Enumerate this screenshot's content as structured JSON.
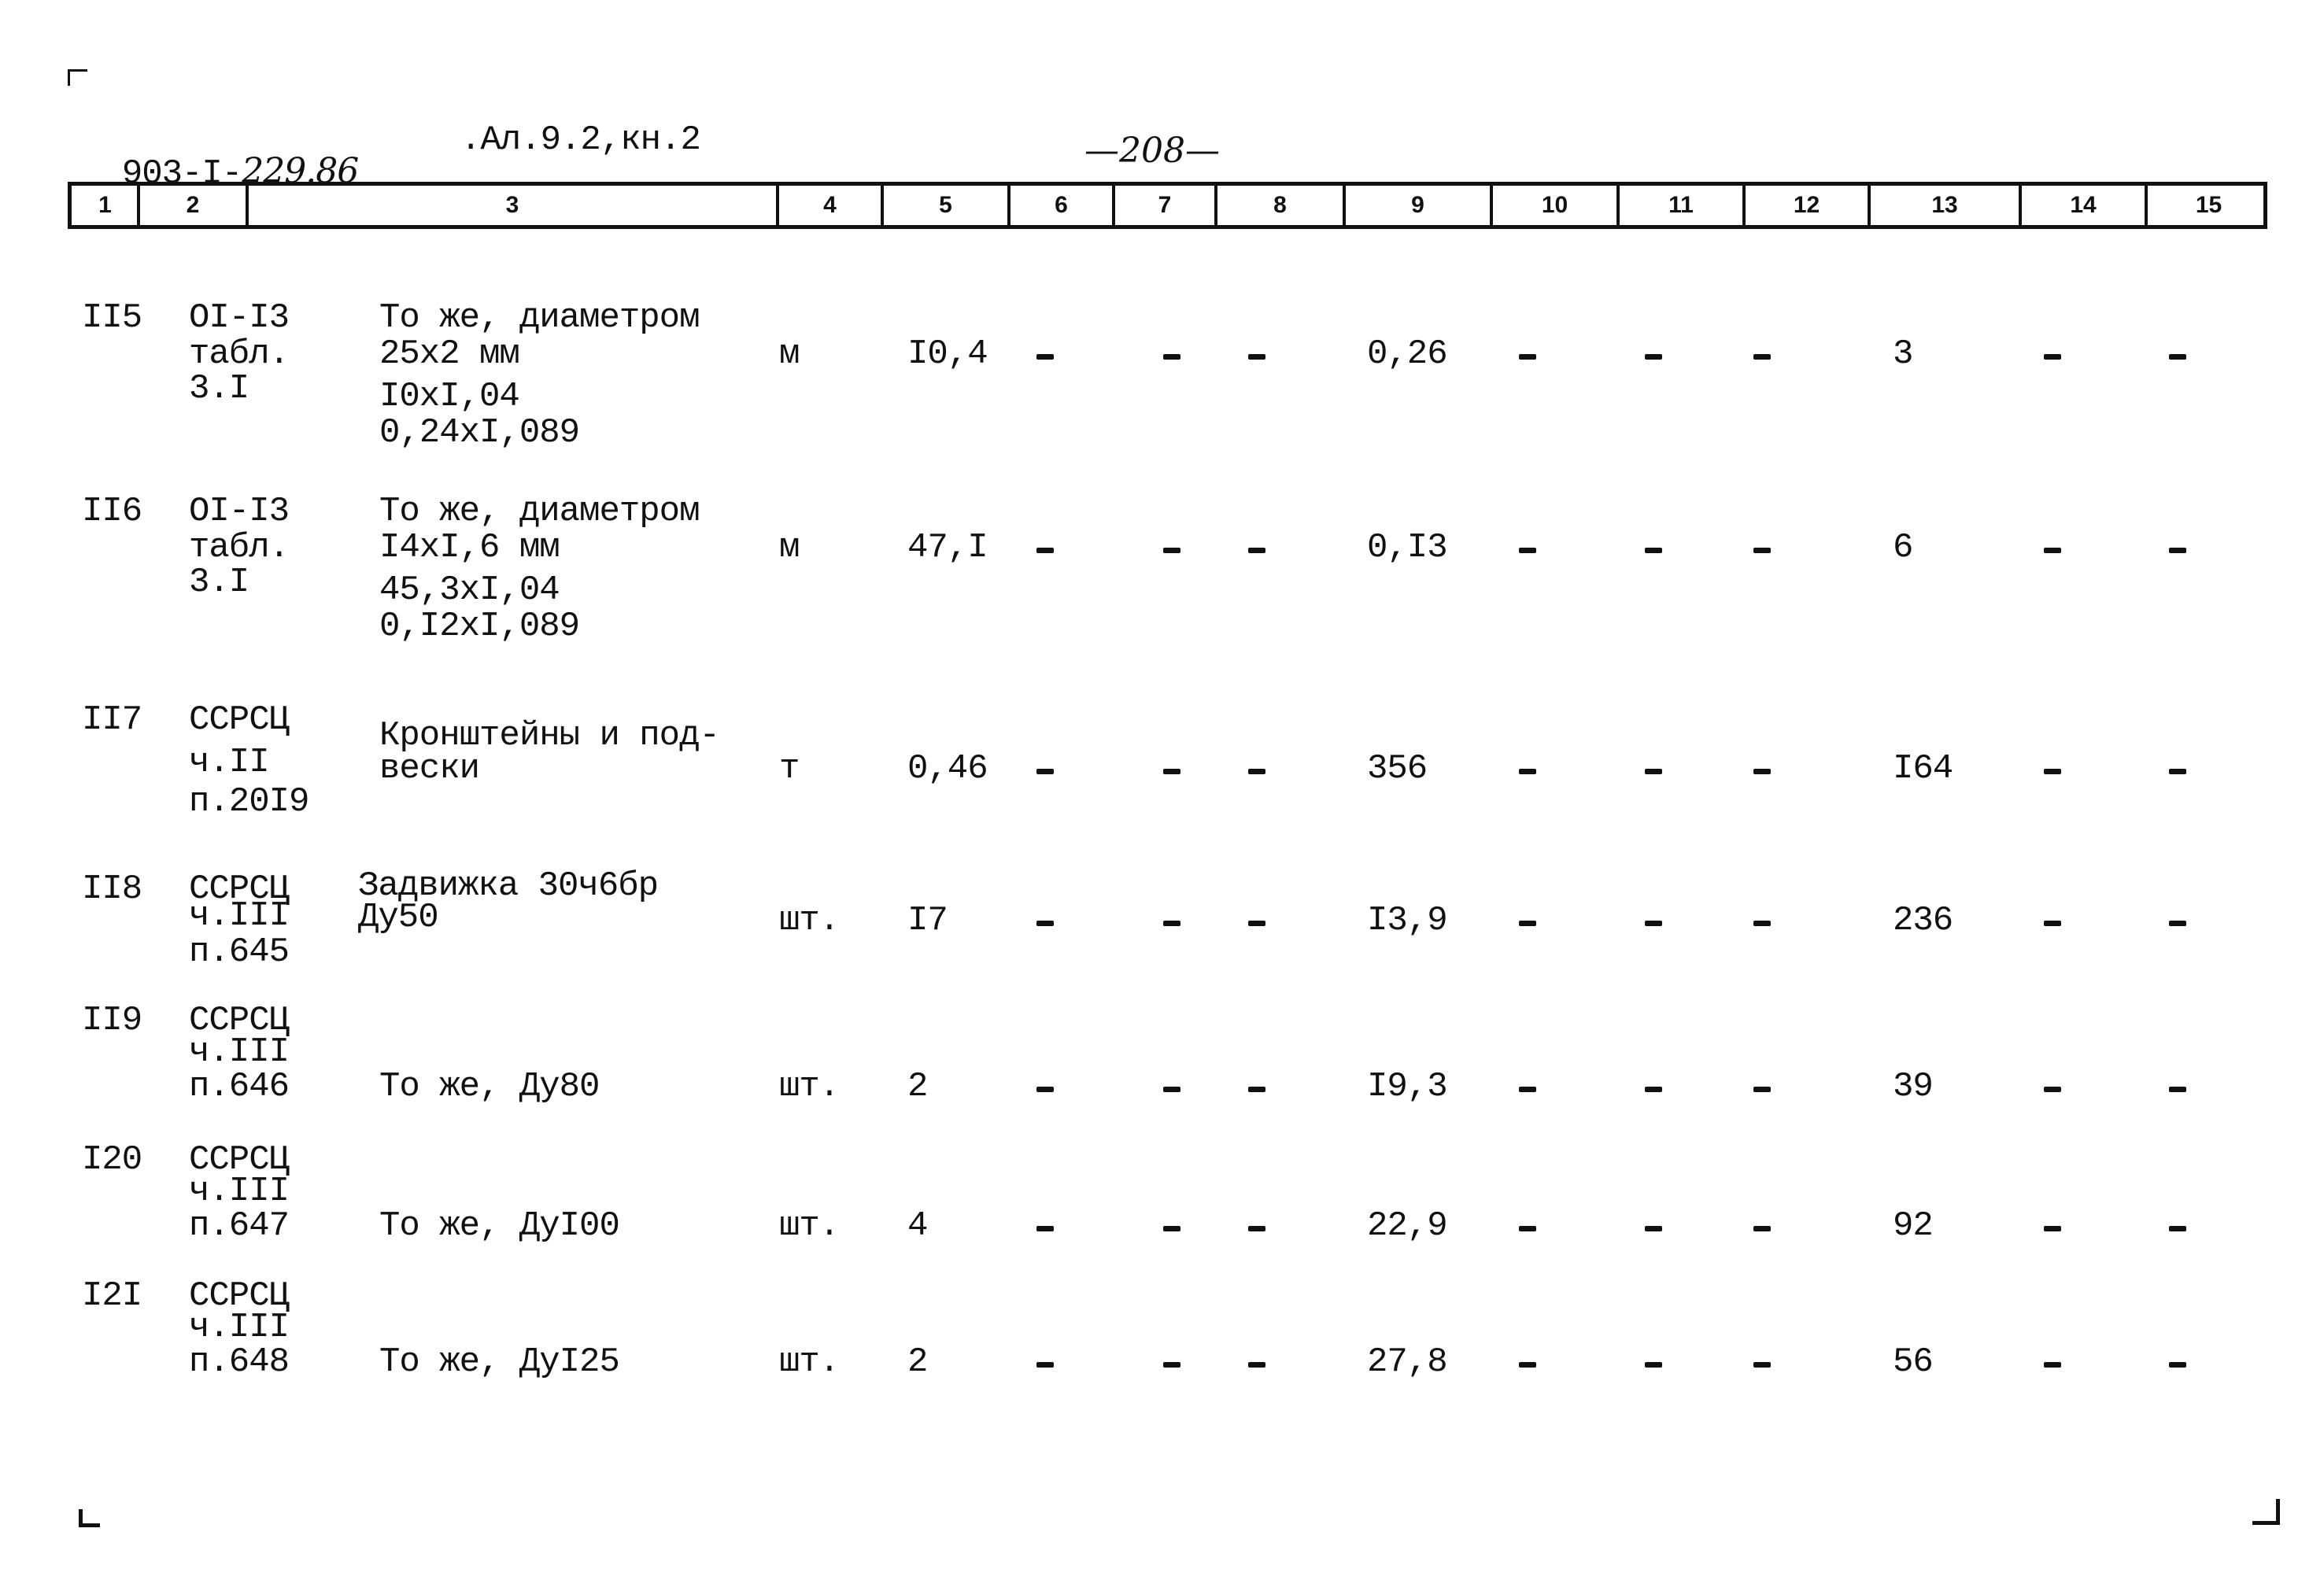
{
  "document": {
    "code_typed": "903-I-",
    "code_handwritten": "229.86",
    "album": ".Ал.9.2,кн.2",
    "page_number": "—208—"
  },
  "table": {
    "column_numbers": [
      "1",
      "2",
      "3",
      "4",
      "5",
      "6",
      "7",
      "8",
      "9",
      "10",
      "11",
      "12",
      "13",
      "14",
      "15"
    ],
    "rows": [
      {
        "num": "II5",
        "ref": [
          "OI-I3",
          "табл.",
          "3.I"
        ],
        "desc": [
          "То же, диаметром",
          "25х2 мм",
          "I0xI,04",
          "0,24xI,089"
        ],
        "unit": "м",
        "qty": "I0,4",
        "c6": "-",
        "c7": "-",
        "c8": "-",
        "c9": "0,26",
        "c10": "-",
        "c11": "-",
        "c12": "-",
        "c13": "3",
        "c14": "-",
        "c15": "-"
      },
      {
        "num": "II6",
        "ref": [
          "OI-I3",
          "табл.",
          "3.I"
        ],
        "desc": [
          "То же, диаметром",
          "I4xI,6 мм",
          "45,3xI,04",
          "0,I2xI,089"
        ],
        "unit": "м",
        "qty": "47,I",
        "c6": "-",
        "c7": "-",
        "c8": "-",
        "c9": "0,I3",
        "c10": "-",
        "c11": "-",
        "c12": "-",
        "c13": "6",
        "c14": "-",
        "c15": "-"
      },
      {
        "num": "II7",
        "ref": [
          "ССРСЦ",
          "ч.II",
          "п.20I9"
        ],
        "desc": [
          "Кронштейны и под-",
          "вески"
        ],
        "unit": "т",
        "qty": "0,46",
        "c6": "-",
        "c7": "-",
        "c8": "-",
        "c9": "356",
        "c10": "-",
        "c11": "-",
        "c12": "-",
        "c13": "I64",
        "c14": "-",
        "c15": "-"
      },
      {
        "num": "II8",
        "ref": [
          "ССРСЦ",
          "ч.III",
          "п.645"
        ],
        "desc": [
          "Задвижка 30ч6бр",
          "Ду50"
        ],
        "unit": "шт.",
        "qty": "I7",
        "c6": "-",
        "c7": "-",
        "c8": "-",
        "c9": "I3,9",
        "c10": "-",
        "c11": "-",
        "c12": "-",
        "c13": "236",
        "c14": "-",
        "c15": "-"
      },
      {
        "num": "II9",
        "ref": [
          "ССРСЦ",
          "ч.III",
          "п.646"
        ],
        "desc": [
          "То же, Ду80"
        ],
        "unit": "шт.",
        "qty": "2",
        "c6": "-",
        "c7": "-",
        "c8": "-",
        "c9": "I9,3",
        "c10": "-",
        "c11": "-",
        "c12": "-",
        "c13": "39",
        "c14": "-",
        "c15": "-"
      },
      {
        "num": "I20",
        "ref": [
          "ССРСЦ",
          "ч.III",
          "п.647"
        ],
        "desc": [
          "То же, ДуI00"
        ],
        "unit": "шт.",
        "qty": "4",
        "c6": "-",
        "c7": "-",
        "c8": "-",
        "c9": "22,9",
        "c10": "-",
        "c11": "-",
        "c12": "-",
        "c13": "92",
        "c14": "-",
        "c15": "-"
      },
      {
        "num": "I2I",
        "ref": [
          "ССРСЦ",
          "ч.III",
          "п.648"
        ],
        "desc": [
          "То же, ДуI25"
        ],
        "unit": "шт.",
        "qty": "2",
        "c6": "-",
        "c7": "-",
        "c8": "-",
        "c9": "27,8",
        "c10": "-",
        "c11": "-",
        "c12": "-",
        "c13": "56",
        "c14": "-",
        "c15": "-"
      }
    ]
  }
}
